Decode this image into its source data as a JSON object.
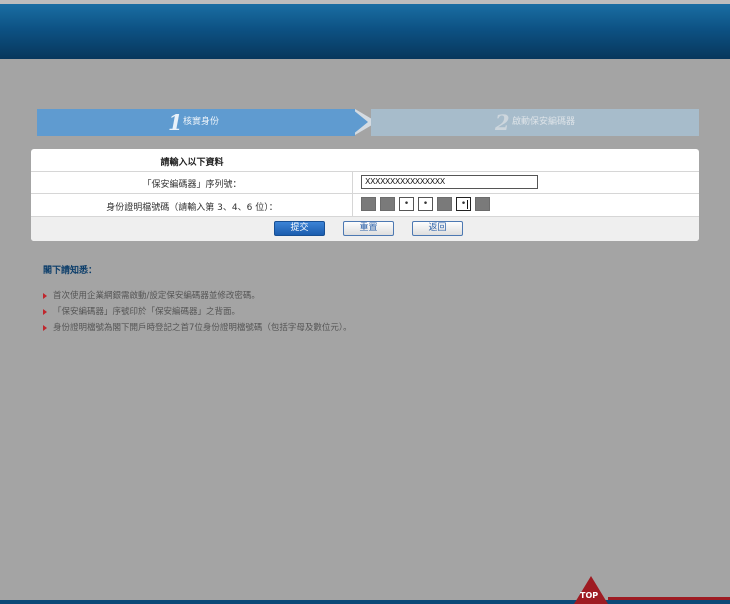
{
  "steps": [
    {
      "number": "1",
      "label": "核實身份"
    },
    {
      "number": "2",
      "label": "啟動保安編碼器"
    }
  ],
  "form": {
    "title": "請輸入以下資料",
    "serial_label": "「保安編碼器」序列號：",
    "serial_value": "XXXXXXXXXXXXXXXX",
    "id_label": "身份證明檔號碼（請輸入第 3、4、6 位）：",
    "id_digits": [
      {
        "type": "masked",
        "value": ""
      },
      {
        "type": "masked",
        "value": ""
      },
      {
        "type": "input",
        "value": "•"
      },
      {
        "type": "input",
        "value": "•"
      },
      {
        "type": "masked",
        "value": ""
      },
      {
        "type": "input",
        "value": "•"
      },
      {
        "type": "masked",
        "value": ""
      }
    ],
    "buttons": {
      "submit": "提交",
      "reset": "重置",
      "back": "返回"
    }
  },
  "notes": {
    "title": "閣下請知悉：",
    "items": [
      "首次使用企業網銀需啟動/設定保安編碼器並修改密碼。",
      "「保安編碼器」序號印於「保安編碼器」之背面。",
      "身份證明檔號為閣下開戶時登記之首7位身份證明檔號碼（包括字母及數位元）。"
    ]
  },
  "footer": {
    "top_label": "TOP"
  },
  "colors": {
    "header": "#0d5284",
    "step_active": "#5f9bd0",
    "step_inactive": "#a7bccb",
    "accent_red": "#9e1b22",
    "background": "#a4a4a4"
  }
}
